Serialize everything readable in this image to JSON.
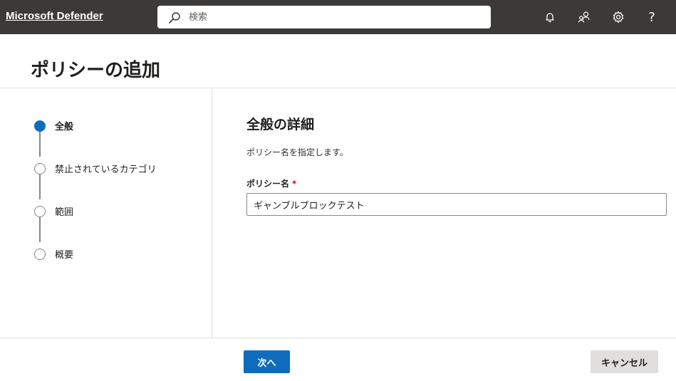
{
  "header": {
    "app_title": "Microsoft Defender",
    "search_placeholder": "検索",
    "icons": [
      "bell-icon",
      "people-community-icon",
      "gear-icon",
      "help-icon"
    ],
    "help_glyph": "?"
  },
  "page": {
    "title": "ポリシーの追加"
  },
  "steps": [
    {
      "label": "全般",
      "active": true
    },
    {
      "label": "禁止されているカテゴリ",
      "active": false
    },
    {
      "label": "範囲",
      "active": false
    },
    {
      "label": "概要",
      "active": false
    }
  ],
  "form": {
    "section_title": "全般の詳細",
    "description": "ポリシー名を指定します。",
    "name_label": "ポリシー名",
    "required_mark": "*",
    "name_value": "ギャンブルブロックテスト"
  },
  "footer": {
    "next_label": "次へ",
    "cancel_label": "キャンセル"
  },
  "colors": {
    "topbar": "#3c3a38",
    "accent": "#0f6cbd"
  }
}
